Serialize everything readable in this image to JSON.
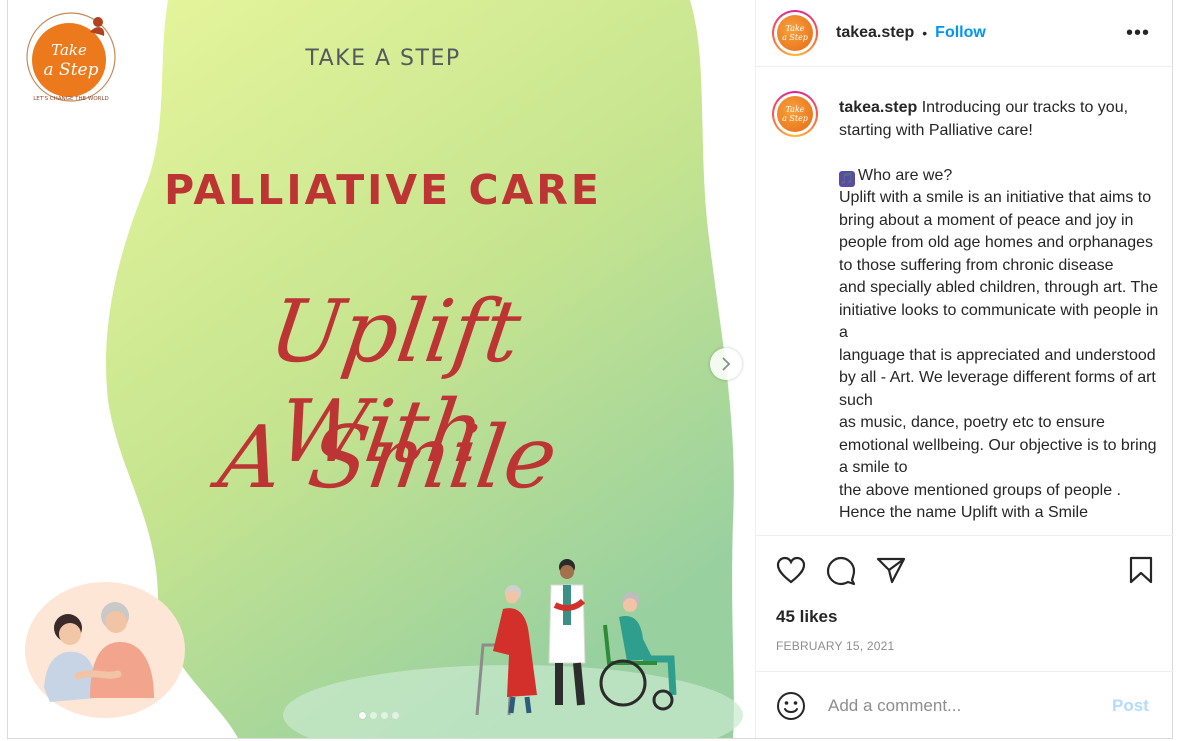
{
  "media": {
    "logo_text": "Take a Step",
    "logo_tagline": "LET'S CHANGE THE WORLD",
    "title_small": "TAKE A STEP",
    "title_big": "PALLIATIVE CARE",
    "script_line1": "Uplift With",
    "script_line2": "A Smile",
    "slide_count": 4,
    "active_slide": 1,
    "colors": {
      "accent_red": "#bd3434",
      "green_light": "#dff196",
      "green_dark": "#9fd39c",
      "logo_orange": "#ec7a1c"
    }
  },
  "header": {
    "username": "takea.step",
    "separator": "•",
    "follow_label": "Follow",
    "more_label": "•••"
  },
  "caption": {
    "username": "takea.step",
    "intro": " Introducing our tracks to you, starting with Palliative care!",
    "heading_emoji": "🎵",
    "heading": "Who are we?",
    "lines": [
      "Uplift with a smile is an initiative that aims to bring about a moment of peace and joy in people from old age homes and orphanages to those suffering from chronic disease",
      "and specially abled children, through art. The initiative looks to communicate with people in a",
      "language that is appreciated and understood by all - Art. We leverage different forms of art such",
      "as music, dance, poetry etc to ensure emotional wellbeing. Our objective is to bring a smile to",
      "the above mentioned groups of people .",
      "Hence the name Uplift with a Smile"
    ]
  },
  "actions": {
    "icons": [
      "heart-icon",
      "comment-icon",
      "share-icon",
      "bookmark-icon"
    ]
  },
  "likes": "45 likes",
  "date": "FEBRUARY 15, 2021",
  "comment": {
    "placeholder": "Add a comment...",
    "post_label": "Post"
  }
}
